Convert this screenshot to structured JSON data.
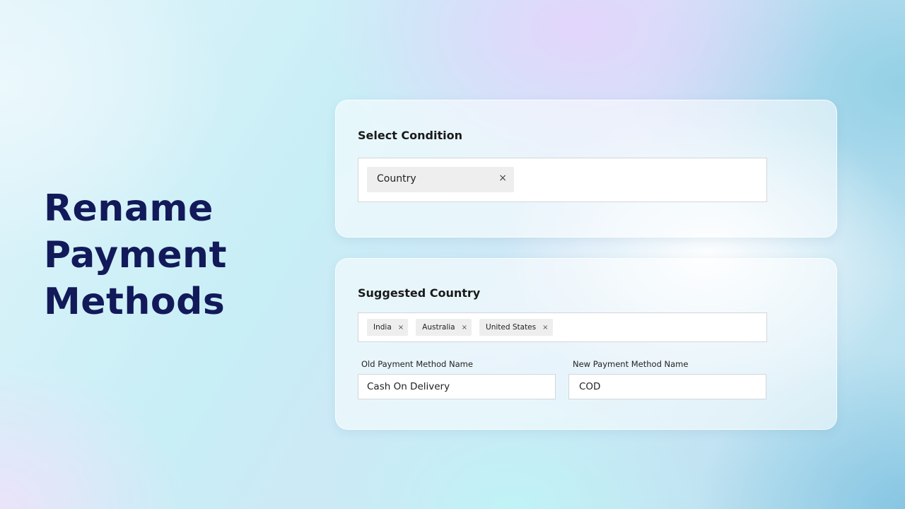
{
  "headline": {
    "lines": [
      "Rename",
      "Payment",
      "Methods"
    ],
    "color": "#121a5a"
  },
  "condition_card": {
    "title": "Select Condition",
    "selected_tag": "Country",
    "remove_icon": "close-icon"
  },
  "suggested_card": {
    "title": "Suggested Country",
    "countries": [
      "India",
      "Australia",
      "United States"
    ],
    "remove_icon": "close-icon",
    "old_name": {
      "label": "Old Payment Method Name",
      "value": "Cash On Delivery"
    },
    "new_name": {
      "label": "New Payment Method Name",
      "value": "COD"
    }
  }
}
